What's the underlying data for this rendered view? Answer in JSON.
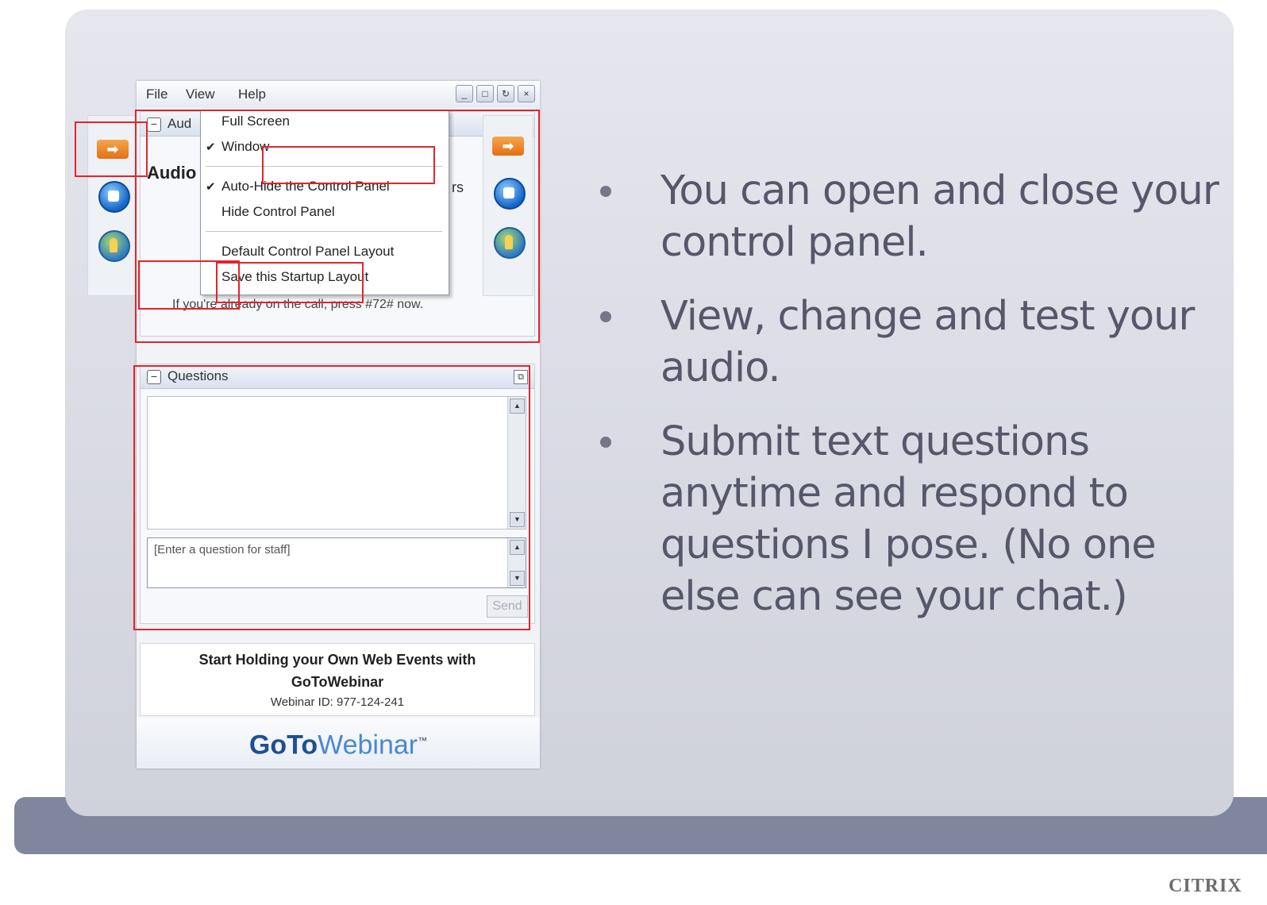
{
  "app": {
    "menu": {
      "file": "File",
      "view": "View",
      "help": "Help"
    },
    "window_buttons": [
      "_",
      "□",
      "↻",
      "×"
    ],
    "audio_panel": {
      "title": "Aud",
      "heading": "Audio",
      "tail": "rs",
      "note": "If you're already on the call, press #72# now."
    },
    "view_menu": {
      "items": [
        {
          "label": "Full Screen",
          "checked": false
        },
        {
          "label": "Window",
          "checked": true
        },
        {
          "label": "Auto-Hide the Control Panel",
          "checked": true
        },
        {
          "label": "Hide Control Panel",
          "checked": false
        },
        {
          "label": "Default Control Panel Layout",
          "checked": false
        },
        {
          "label": "Save this Startup Layout",
          "checked": false
        }
      ],
      "check_glyph": "✔"
    },
    "questions": {
      "title": "Questions",
      "input_placeholder": "[Enter a question for staff]",
      "send_label": "Send"
    },
    "promo": {
      "line1": "Start Holding your Own Web Events with",
      "line2": "GoToWebinar",
      "webinar_id": "Webinar ID: 977-124-241"
    },
    "brand": {
      "part1": "GoTo",
      "part2": "Webinar",
      "tm": "™"
    }
  },
  "bullets": [
    "You can open and close your control panel.",
    "View, change and test your audio.",
    "Submit text questions anytime and respond to questions I pose. (No one else can see your chat.)"
  ],
  "footer": {
    "logo": "CITRIX"
  },
  "icons": {
    "arrow": "arrow-right-icon",
    "audio": "audio-icon",
    "globe": "globe-icon"
  },
  "colors": {
    "highlight": "#e0262b",
    "bullet_text": "#56576a",
    "slide_bar": "#7f869d"
  }
}
